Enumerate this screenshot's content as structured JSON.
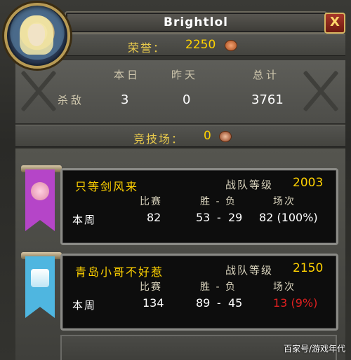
{
  "window": {
    "title": "Brightlol",
    "close_label": "X"
  },
  "honor": {
    "label": "荣誉：",
    "value": "2250"
  },
  "kills": {
    "col_today": "本日",
    "col_yesterday": "昨天",
    "col_total": "总计",
    "row_label": "杀敌",
    "today": "3",
    "yesterday": "0",
    "total": "3761"
  },
  "arena": {
    "label": "竞技场：",
    "value": "0"
  },
  "teams": [
    {
      "name": "只等剑风来",
      "rating_label": "战队等级",
      "rating": "2003",
      "h_games": "比赛",
      "h_wl": "胜 - 负",
      "h_played": "场次",
      "week_label": "本周",
      "games": "82",
      "wins": "53",
      "dash": "-",
      "losses": "29",
      "played": "82 (100%)",
      "banner_color": "#b545c8",
      "played_color": "#ffffff"
    },
    {
      "name": "青岛小哥不好惹",
      "rating_label": "战队等级",
      "rating": "2150",
      "h_games": "比赛",
      "h_wl": "胜 - 负",
      "h_played": "场次",
      "week_label": "本周",
      "games": "134",
      "wins": "89",
      "dash": "-",
      "losses": "45",
      "played": "13 (9%)",
      "banner_color": "#4fb6e0",
      "played_color": "#e02020"
    }
  ],
  "watermark": "百家号/游戏年代"
}
